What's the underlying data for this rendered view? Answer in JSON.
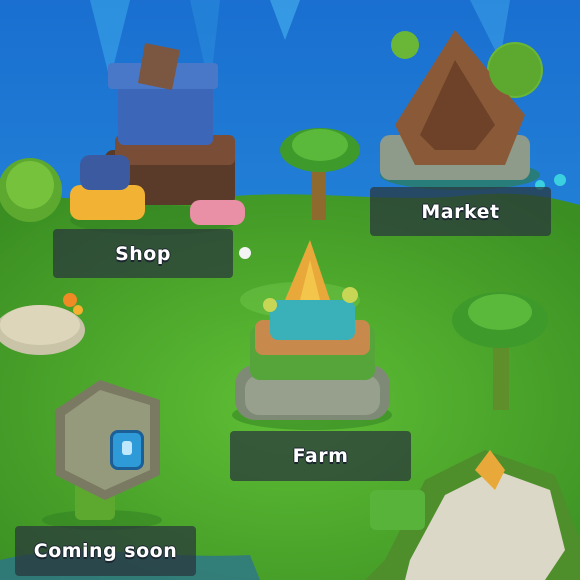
{
  "buildings": {
    "shop": {
      "label": "Shop"
    },
    "market": {
      "label": "Market"
    },
    "farm": {
      "label": "Farm"
    },
    "locked": {
      "label": "Coming soon",
      "icon": "lock-icon"
    }
  },
  "colors": {
    "sky": "#1f7fd6",
    "grass": "#4fae2e",
    "label_bg": "#2c3a44"
  }
}
